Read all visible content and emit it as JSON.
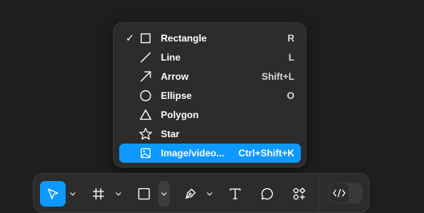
{
  "shape_menu": {
    "items": [
      {
        "label": "Rectangle",
        "shortcut": "R",
        "checked": true,
        "selected": false,
        "icon": "rectangle-icon"
      },
      {
        "label": "Line",
        "shortcut": "L",
        "checked": false,
        "selected": false,
        "icon": "line-icon"
      },
      {
        "label": "Arrow",
        "shortcut": "Shift+L",
        "checked": false,
        "selected": false,
        "icon": "arrow-icon"
      },
      {
        "label": "Ellipse",
        "shortcut": "O",
        "checked": false,
        "selected": false,
        "icon": "ellipse-icon"
      },
      {
        "label": "Polygon",
        "shortcut": "",
        "checked": false,
        "selected": false,
        "icon": "polygon-icon"
      },
      {
        "label": "Star",
        "shortcut": "",
        "checked": false,
        "selected": false,
        "icon": "star-icon"
      },
      {
        "label": "Image/video...",
        "shortcut": "Ctrl+Shift+K",
        "checked": false,
        "selected": true,
        "icon": "image-icon"
      }
    ],
    "check_glyph": "✓"
  },
  "toolbar": {
    "tools": [
      {
        "name": "move-tool",
        "icon": "cursor-icon",
        "active": true,
        "has_dropdown": true
      },
      {
        "name": "frame-tool",
        "icon": "frame-icon",
        "active": false,
        "has_dropdown": true
      },
      {
        "name": "shape-tool",
        "icon": "square-icon",
        "active": false,
        "has_dropdown": true,
        "dropdown_open": true
      },
      {
        "name": "pen-tool",
        "icon": "pen-icon",
        "active": false,
        "has_dropdown": true
      },
      {
        "name": "text-tool",
        "icon": "text-icon",
        "active": false,
        "has_dropdown": false
      },
      {
        "name": "comment-tool",
        "icon": "comment-icon",
        "active": false,
        "has_dropdown": false
      },
      {
        "name": "actions-tool",
        "icon": "actions-icon",
        "active": false,
        "has_dropdown": false
      }
    ],
    "dev_mode_toggle": {
      "icon": "code-icon",
      "on": false
    }
  },
  "colors": {
    "canvas": "#1e1e1e",
    "panel": "#2c2c2c",
    "accent": "#0d99ff",
    "text": "#ffffff"
  }
}
